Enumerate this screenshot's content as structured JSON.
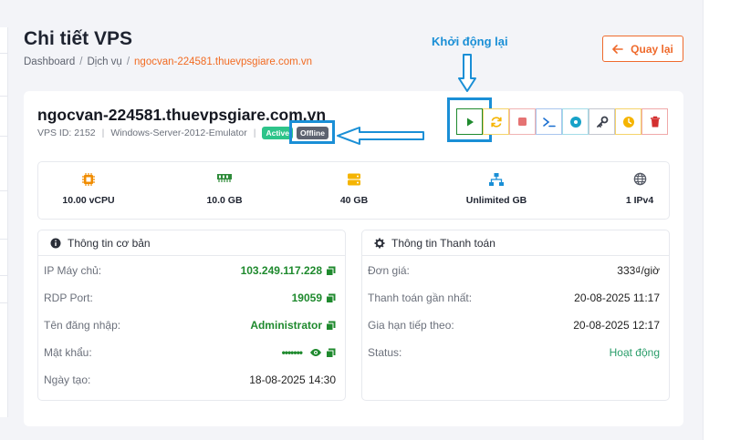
{
  "page": {
    "title": "Chi tiết VPS",
    "breadcrumb": [
      "Dashboard",
      "Dịch vụ",
      "ngocvan-224581.thuevpsgiare.com.vn"
    ],
    "back_label": "Quay lại"
  },
  "annotation": {
    "label": "Khởi động lại"
  },
  "vps": {
    "name": "ngocvan-224581.thuevpsgiare.com.vn",
    "id_text": "VPS ID: 2152",
    "os": "Windows-Server-2012-Emulator",
    "status_badge": "Active",
    "power_badge": "Offline"
  },
  "actions": [
    {
      "name": "start",
      "icon": "play-icon",
      "color": "#1f8a2e"
    },
    {
      "name": "restart",
      "icon": "refresh-icon",
      "color": "#f5b400"
    },
    {
      "name": "stop",
      "icon": "stop-icon",
      "color": "#e57373"
    },
    {
      "name": "console",
      "icon": "terminal-icon",
      "color": "#1a6fd0"
    },
    {
      "name": "reinstall",
      "icon": "disc-icon",
      "color": "#17a2c8"
    },
    {
      "name": "password",
      "icon": "key-icon",
      "color": "#3a3f4b"
    },
    {
      "name": "renew",
      "icon": "clock-icon",
      "color": "#f5b400"
    },
    {
      "name": "delete",
      "icon": "trash-icon",
      "color": "#d32f2f"
    }
  ],
  "specs": [
    {
      "icon": "cpu-icon",
      "value": "10.00 vCPU",
      "color": "#f08c00"
    },
    {
      "icon": "ram-icon",
      "value": "10.0 GB",
      "color": "#2e8b3a"
    },
    {
      "icon": "disk-icon",
      "value": "40 GB",
      "color": "#f5b400"
    },
    {
      "icon": "network-icon",
      "value": "Unlimited GB",
      "color": "#1a8fd6"
    },
    {
      "icon": "globe-icon",
      "value": "1 IPv4",
      "color": "#555a66"
    }
  ],
  "basic_info": {
    "title": "Thông tin cơ bản",
    "rows": [
      {
        "key": "IP Máy chủ:",
        "value": "103.249.117.228"
      },
      {
        "key": "RDP Port:",
        "value": "19059"
      },
      {
        "key": "Tên đăng nhập:",
        "value": "Administrator"
      },
      {
        "key": "Mật khẩu:",
        "value": "•••••••"
      },
      {
        "key": "Ngày tạo:",
        "value": "18-08-2025 14:30"
      }
    ]
  },
  "billing_info": {
    "title": "Thông tin Thanh toán",
    "rows": [
      {
        "key": "Đơn giá:",
        "value": "333₫/giờ"
      },
      {
        "key": "Thanh toán gần nhất:",
        "value": "20-08-2025 11:17"
      },
      {
        "key": "Gia hạn tiếp theo:",
        "value": "20-08-2025 12:17"
      },
      {
        "key": "Status:",
        "value": "Hoạt động"
      }
    ]
  }
}
